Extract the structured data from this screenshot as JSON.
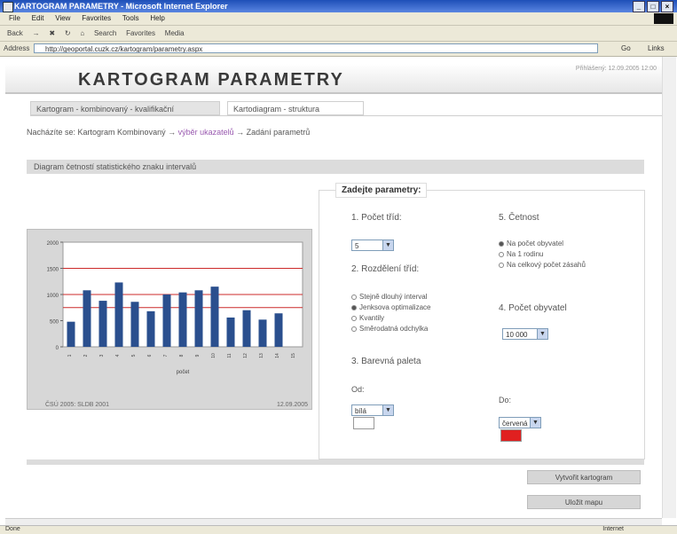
{
  "browser": {
    "title": "KARTOGRAM PARAMETRY - Microsoft Internet Explorer",
    "menu": [
      "File",
      "Edit",
      "View",
      "Favorites",
      "Tools",
      "Help"
    ],
    "toolbar": [
      "Back",
      "Search",
      "Favorites",
      "Media"
    ],
    "address_label": "Address",
    "address": "http://geoportal.cuzk.cz/kartogram/parametry.aspx",
    "go_label": "Go",
    "links_label": "Links",
    "status_left": "Done",
    "status_right": "Internet"
  },
  "header": {
    "title": "KARTOGRAM PARAMETRY",
    "right_text": "Přihlášený: 12.09.2005 12:00"
  },
  "tabs": [
    {
      "label": "Kartogram - kombinovaný - kvalifikační"
    },
    {
      "label": "Kartodiagram - struktura"
    }
  ],
  "breadcrumb": {
    "prefix": "Nacházíte se: Kartogram Kombinovaný →",
    "link": "výběr ukazatelů",
    "suffix": "→ Zadání parametrů"
  },
  "section": {
    "title": "Diagram četností statistického znaku intervalů"
  },
  "chart_data": {
    "type": "bar",
    "categories": [
      "1",
      "2",
      "3",
      "4",
      "5",
      "6",
      "7",
      "8",
      "9",
      "10",
      "11",
      "12",
      "13",
      "14",
      "15"
    ],
    "values": [
      480,
      1080,
      880,
      1230,
      860,
      680,
      1000,
      1040,
      1080,
      1150,
      560,
      700,
      520,
      640,
      0
    ],
    "xlabel": "počet",
    "ylabel": "",
    "ylim": [
      0,
      2000
    ],
    "yticks": [
      0,
      500,
      1000,
      1500,
      2000
    ],
    "reference_lines": [
      750,
      1000,
      1500
    ],
    "bar_color": "#2a4f8e",
    "line_color": "#cc2a2a",
    "source": "ČSÚ 2005: SLDB 2001",
    "date": "12.09.2005"
  },
  "params": {
    "legend": "Zadejte parametry:",
    "p1": {
      "title": "1. Počet tříd:",
      "value": "5"
    },
    "p2": {
      "title": "2. Rozdělení tříd:",
      "options": [
        {
          "label": "Stejně dlouhý interval",
          "selected": false
        },
        {
          "label": "Jenksova optimalizace",
          "selected": true
        },
        {
          "label": "Kvantily",
          "selected": false
        },
        {
          "label": "Směrodatná odchylka",
          "selected": false
        }
      ]
    },
    "p3": {
      "title": "3. Barevná paleta",
      "from_label": "Od:",
      "from_value": "bílá",
      "to_label": "Do:",
      "to_value": "červená"
    },
    "p5": {
      "title": "5. Četnost",
      "options": [
        {
          "label": "Na počet obyvatel",
          "selected": true
        },
        {
          "label": "Na 1 rodinu",
          "selected": false
        },
        {
          "label": "Na celkový počet zásahů",
          "selected": false
        }
      ]
    },
    "p4": {
      "title": "4. Počet obyvatel",
      "value": "10 000"
    }
  },
  "buttons": {
    "create": "Vytvořit kartogram",
    "save": "Uložit mapu"
  },
  "colors": {
    "palette_from": "#ffffff",
    "palette_to": "#e02020"
  }
}
